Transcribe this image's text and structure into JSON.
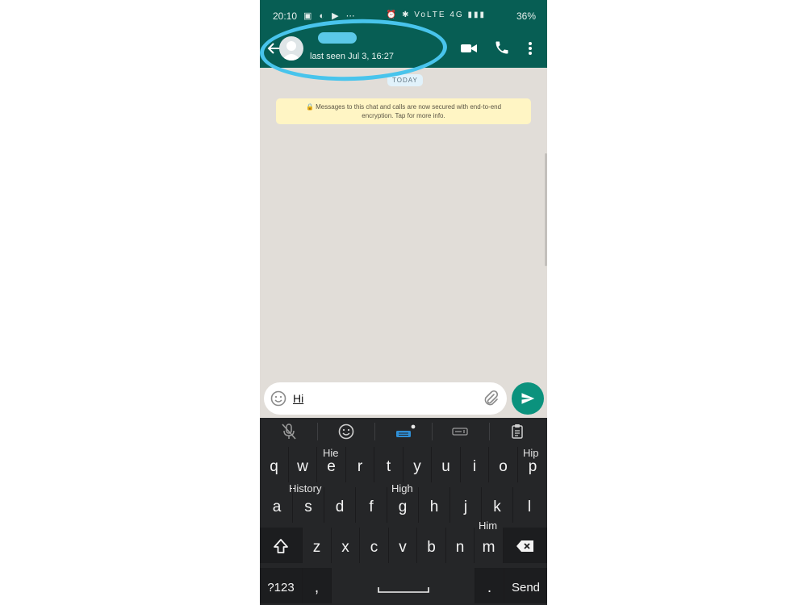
{
  "status_bar": {
    "time": "20:10",
    "left_icons": "▣ ◐ ▶ ⋯",
    "right_icons": "⏰ ✱ VoLTE 4G ▮▮▮",
    "battery": "36%"
  },
  "header": {
    "last_seen": "last seen Jul 3, 16:27"
  },
  "chat": {
    "date_chip": "TODAY",
    "encryption_note": "🔒 Messages to this chat and calls are now secured with end-to-end encryption. Tap for more info."
  },
  "composer": {
    "value": "Hi"
  },
  "keyboard": {
    "suggestions": {
      "hie": "Hie",
      "hip": "Hip",
      "history": "History",
      "high": "High",
      "him": "Him"
    },
    "row1": [
      "q",
      "w",
      "e",
      "r",
      "t",
      "y",
      "u",
      "i",
      "o",
      "p"
    ],
    "row2": [
      "a",
      "s",
      "d",
      "f",
      "g",
      "h",
      "j",
      "k",
      "l"
    ],
    "row3": [
      "z",
      "x",
      "c",
      "v",
      "b",
      "n",
      "m"
    ],
    "symbols_label": "?123",
    "comma_label": ",",
    "period_label": ".",
    "send_label": "Send"
  },
  "colors": {
    "header_green": "#075e54",
    "accent_green": "#0b927d",
    "highlight_blue": "#48c4ec",
    "chat_background": "#e1ddd8",
    "encryption_yellow": "#fff5c4",
    "keyboard_background": "#252628"
  }
}
